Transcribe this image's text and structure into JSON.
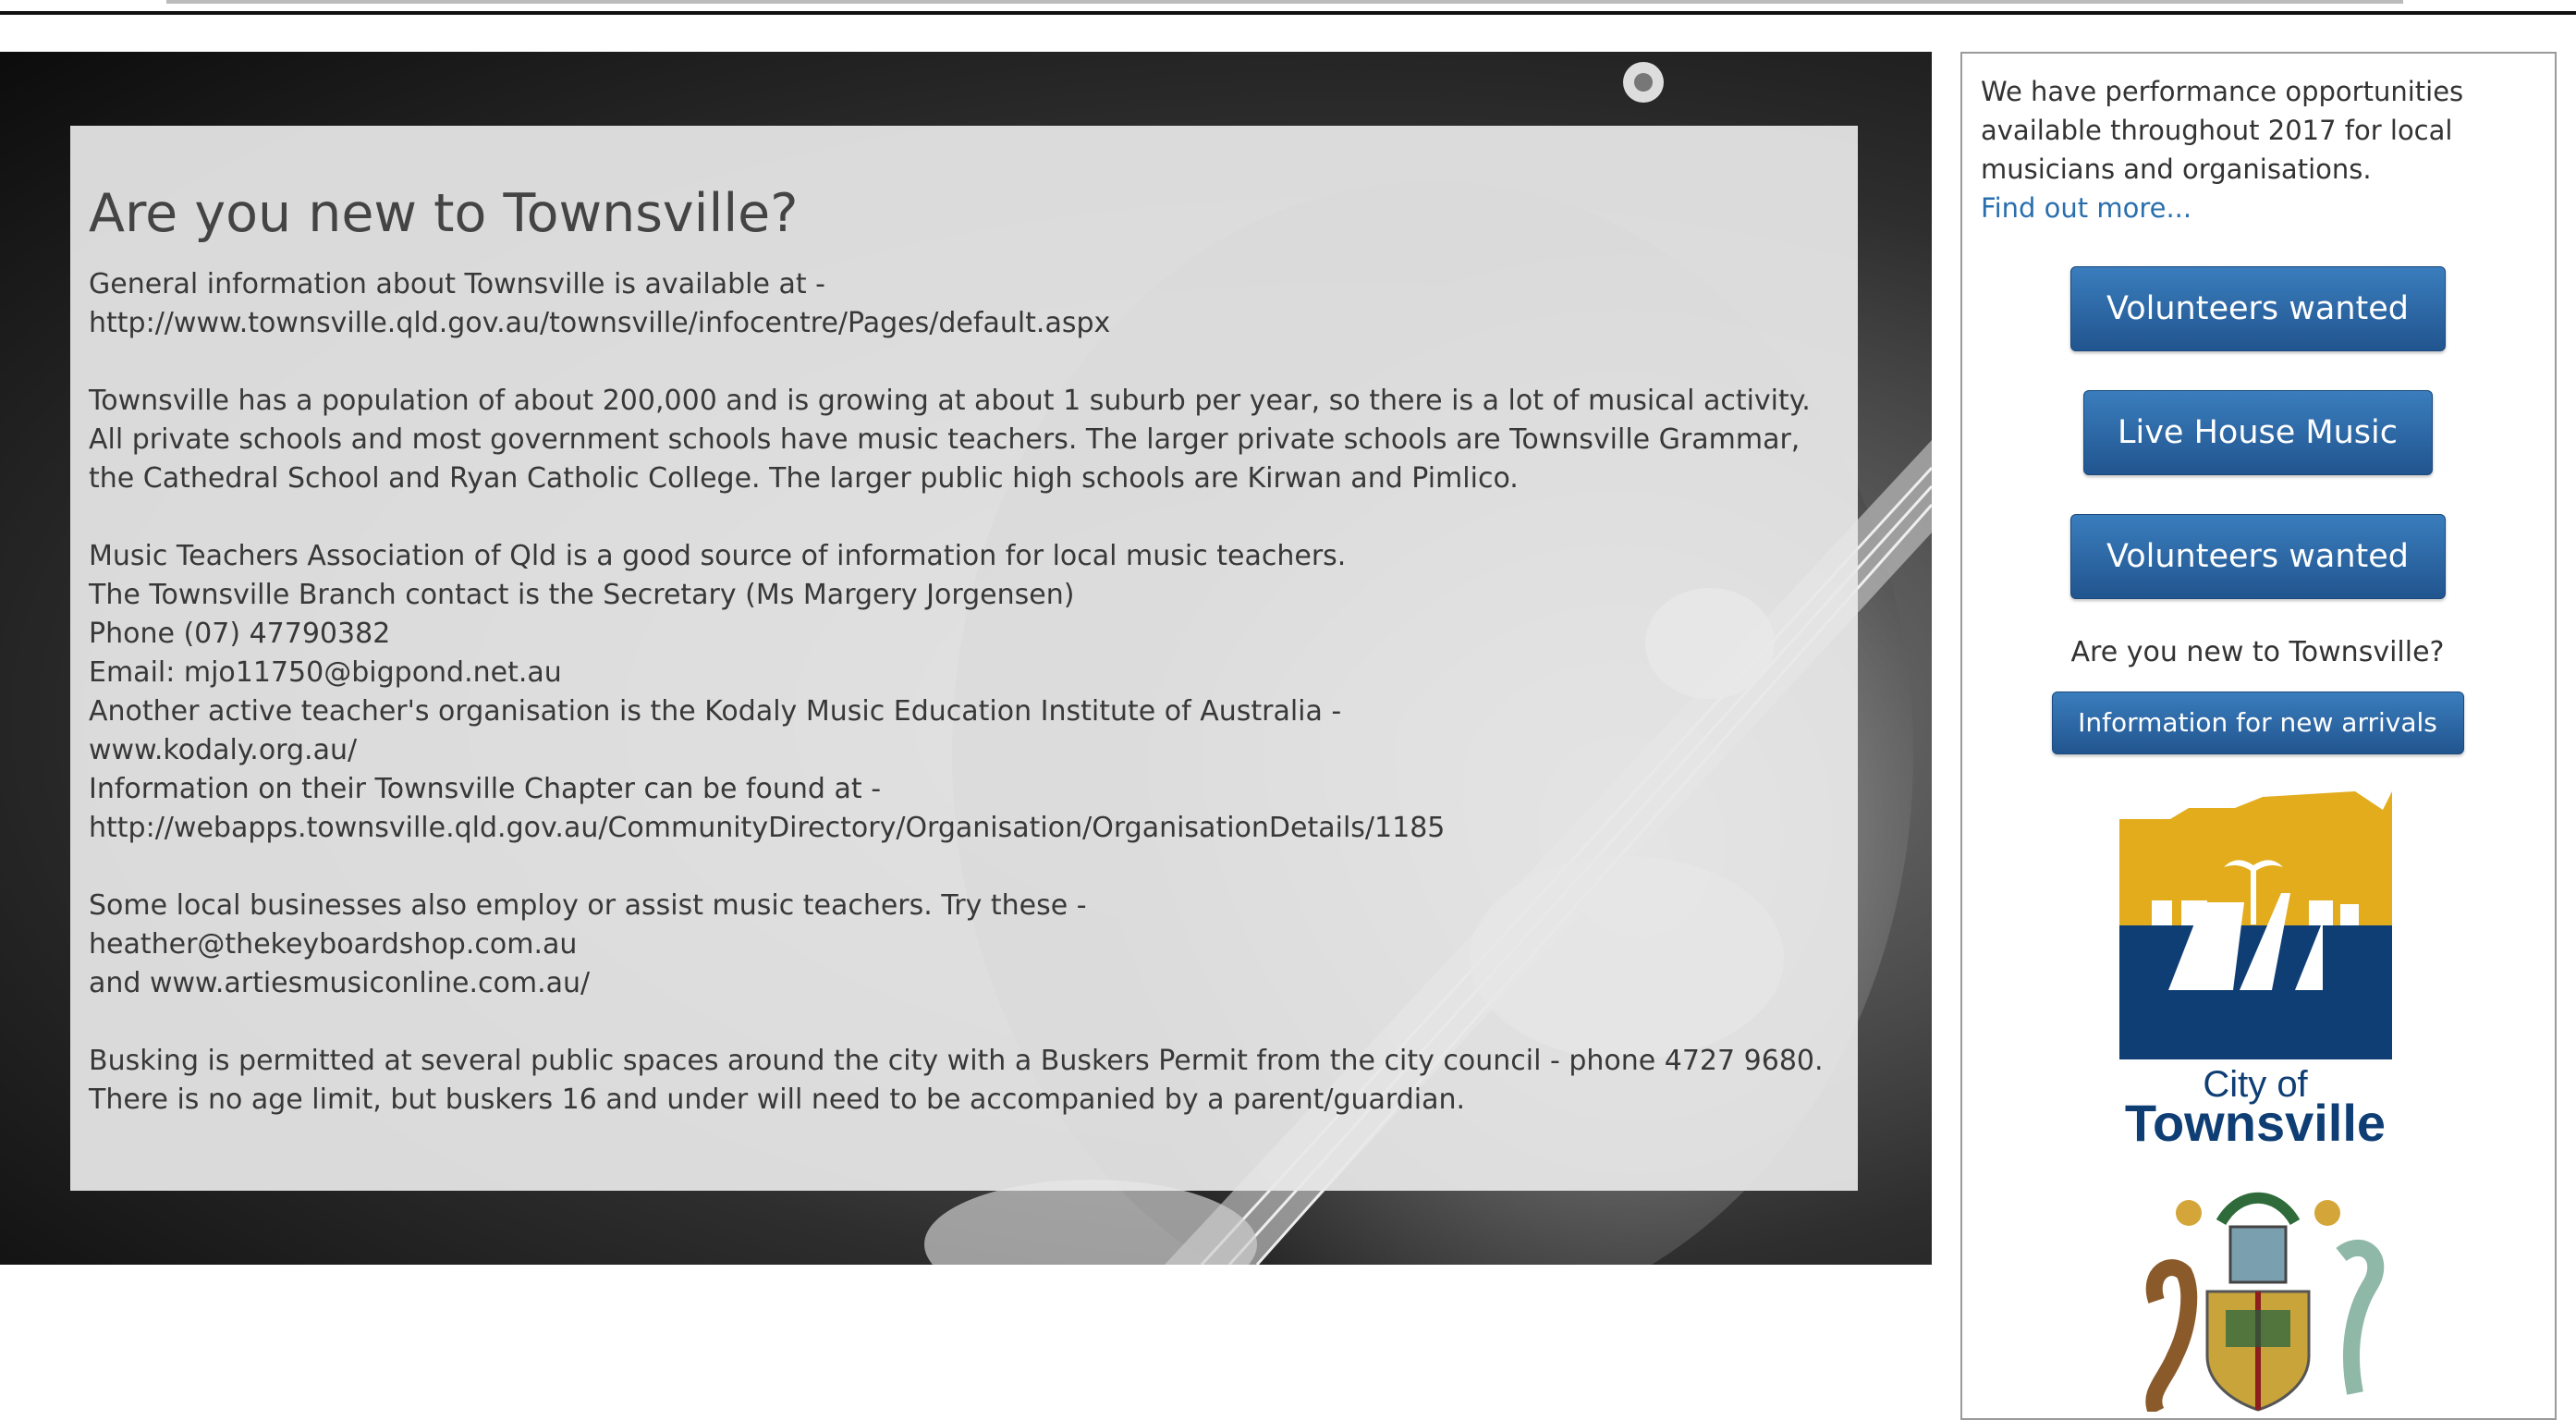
{
  "main": {
    "title": "Are you new to Townsville?",
    "paragraphs": [
      [
        "General information about Townsville is available at -",
        "http://www.townsville.qld.gov.au/townsville/infocentre/Pages/default.aspx"
      ],
      [
        "Townsville has a population of about 200,000 and is growing at about 1 suburb per year, so there is a lot of musical activity.",
        "All private schools and most government schools have music teachers. The larger private schools are Townsville Grammar,",
        "the Cathedral School and Ryan Catholic College. The larger public high schools are Kirwan and Pimlico."
      ],
      [
        "Music Teachers Association of Qld is a good source of information for local music teachers.",
        "The Townsville Branch contact is the Secretary (Ms Margery Jorgensen)",
        "Phone (07) 47790382",
        "Email: mjo11750@bigpond.net.au",
        "Another active teacher's organisation is the Kodaly Music Education Institute of Australia -",
        "www.kodaly.org.au/",
        "Information on their Townsville Chapter can be found at -",
        "http://webapps.townsville.qld.gov.au/CommunityDirectory/Organisation/OrganisationDetails/1185"
      ],
      [
        "Some local businesses also employ or assist music teachers. Try these -",
        "heather@thekeyboardshop.com.au",
        "and www.artiesmusiconline.com.au/"
      ],
      [
        "Busking is permitted at several public spaces around the city with a Buskers Permit from the city council - phone 4727 9680.",
        "There is no age limit, but buskers 16 and under will need to be accompanied by a parent/guardian."
      ]
    ]
  },
  "sidebar": {
    "intro_lines": [
      "We have performance opportunities",
      "available throughout 2017 for local",
      "musicians and organisations."
    ],
    "find_more": "Find out more...",
    "buttons": [
      "Volunteers wanted",
      "Live House Music",
      "Volunteers wanted"
    ],
    "question": "Are you new to Townsville?",
    "info_button": "Information for new arrivals",
    "logo": {
      "line1": "City of",
      "line2": "Townsville",
      "colors": {
        "gold": "#e2ac1c",
        "navy": "#0f3e75"
      }
    }
  },
  "colors": {
    "button_blue": "#2a65a3",
    "link_blue": "#2a6fad",
    "panel_grey": "#e8e8e8"
  }
}
